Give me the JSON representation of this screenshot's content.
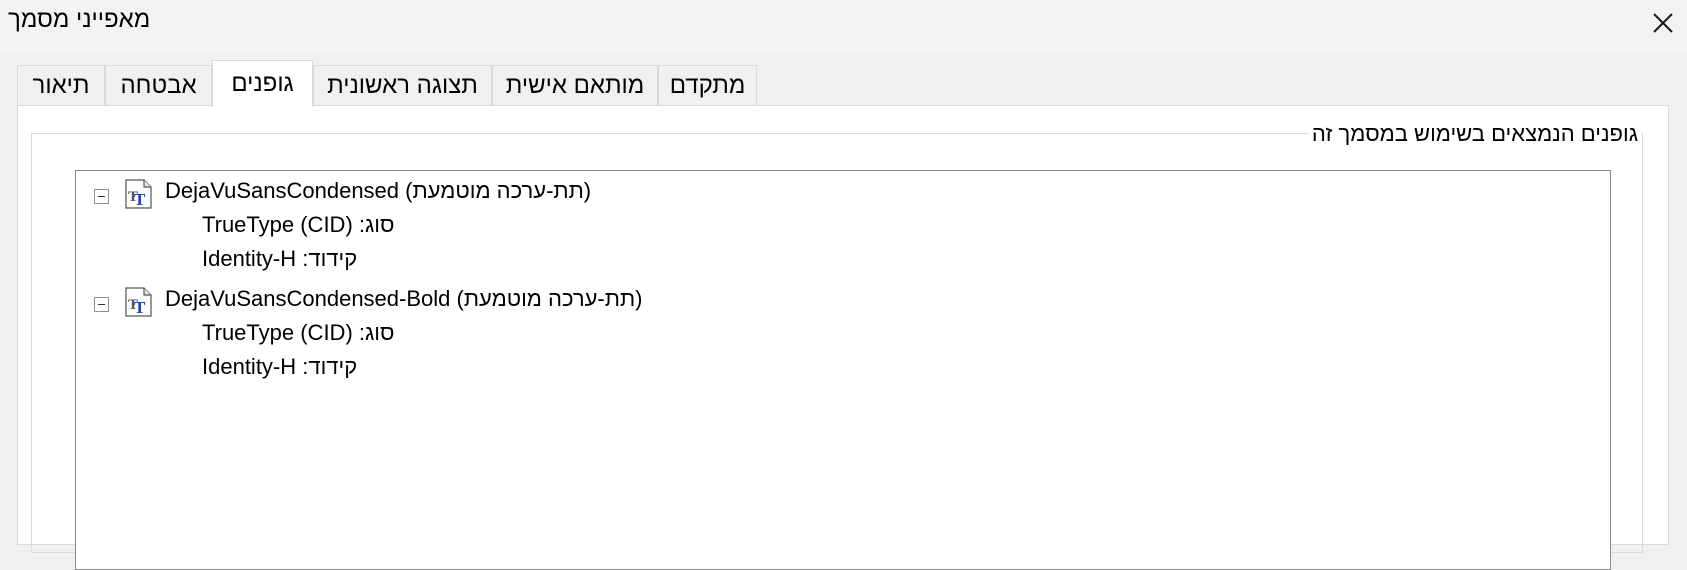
{
  "window": {
    "title": "מאפייני מסמך",
    "close_icon": "close-icon"
  },
  "tabs": [
    {
      "label": "תיאור",
      "active": false
    },
    {
      "label": "אבטחה",
      "active": false
    },
    {
      "label": "גופנים",
      "active": true
    },
    {
      "label": "תצוגה ראשונית",
      "active": false
    },
    {
      "label": "מותאם אישית",
      "active": false
    },
    {
      "label": "מתקדם",
      "active": false
    }
  ],
  "fonts_group": {
    "legend": "גופנים הנמצאים בשימוש במסמך זה",
    "fonts": [
      {
        "label": "DejaVuSansCondensed (תת-ערכה מוטמעת)",
        "icon": "truetype-font-icon",
        "expanded": true,
        "type_line": "סוג: TrueType (CID)",
        "encoding_line": "קידוד: Identity-H"
      },
      {
        "label": "DejaVuSansCondensed-Bold (תת-ערכה מוטמעת)",
        "icon": "truetype-font-icon",
        "expanded": true,
        "type_line": "סוג: TrueType (CID)",
        "encoding_line": "קידוד: Identity-H"
      }
    ]
  }
}
